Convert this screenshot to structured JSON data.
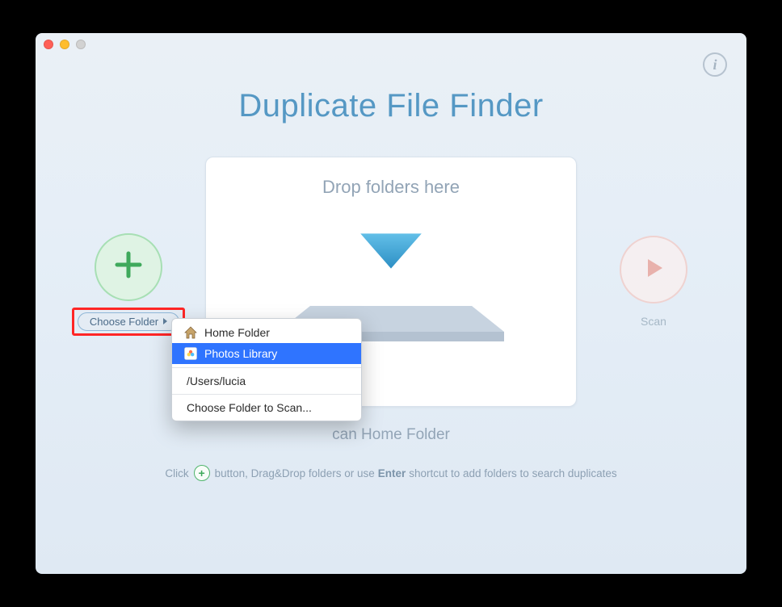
{
  "app": {
    "title": "Duplicate File Finder"
  },
  "toolbar": {
    "info_tooltip": "i"
  },
  "left": {
    "choose_folder_label": "Choose Folder"
  },
  "right": {
    "scan_label": "Scan"
  },
  "drop": {
    "title": "Drop folders here"
  },
  "subtitle_partial": "can Home Folder",
  "hint": {
    "prefix": "Click",
    "mid1": "button, Drag&Drop folders or use",
    "bold": "Enter",
    "suffix": "shortcut to add folders to search duplicates"
  },
  "menu": {
    "items": [
      {
        "label": "Home Folder",
        "icon": "home-icon"
      },
      {
        "label": "Photos Library",
        "icon": "photos-icon",
        "selected": true
      },
      {
        "label": "/Users/lucia"
      },
      {
        "label": "Choose Folder to Scan..."
      }
    ]
  }
}
